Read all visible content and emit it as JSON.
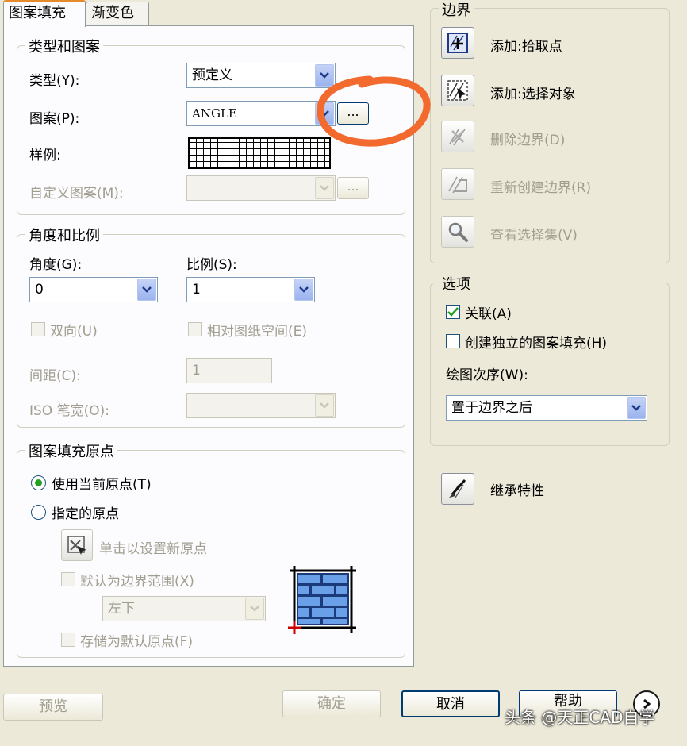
{
  "tabs": [
    {
      "label": "图案填充",
      "active": true
    },
    {
      "label": "渐变色",
      "active": false
    }
  ],
  "type_pattern": {
    "title": "类型和图案",
    "type_label": "类型(Y):",
    "type_value": "预定义",
    "pattern_label": "图案(P):",
    "pattern_value": "ANGLE",
    "browse_button": "...",
    "swatch_label": "样例:",
    "custom_label": "自定义图案(M):",
    "custom_browse": "..."
  },
  "angle_scale": {
    "title": "角度和比例",
    "angle_label": "角度(G):",
    "angle_value": "0",
    "scale_label": "比例(S):",
    "scale_value": "1",
    "double_label": "双向(U)",
    "relative_label": "相对图纸空间(E)",
    "spacing_label": "间距(C):",
    "spacing_value": "1",
    "iso_label": "ISO 笔宽(O):"
  },
  "origin": {
    "title": "图案填充原点",
    "use_current_label": "使用当前原点(T)",
    "specified_label": "指定的原点",
    "click_set_label": "单击以设置新原点",
    "default_boundary_label": "默认为边界范围(X)",
    "position_value": "左下",
    "store_default_label": "存储为默认原点(F)"
  },
  "boundary": {
    "title": "边界",
    "add_pick": "添加:拾取点",
    "add_select": "添加:选择对象",
    "remove": "删除边界(D)",
    "recreate": "重新创建边界(R)",
    "view_selection": "查看选择集(V)"
  },
  "options": {
    "title": "选项",
    "associative_label": "关联(A)",
    "associative_checked": true,
    "independent_label": "创建独立的图案填充(H)",
    "independent_checked": false,
    "draw_order_label": "绘图次序(W):",
    "draw_order_value": "置于边界之后"
  },
  "inherit": {
    "label": "继承特性"
  },
  "footer": {
    "preview": "预览",
    "ok": "确定",
    "cancel": "取消",
    "help": "帮助"
  },
  "watermark": "头条 @天正CAD自学",
  "colors": {
    "annotation": "#f26a2e",
    "accent": "#003c74",
    "dialog_bg": "#ece9d8"
  }
}
